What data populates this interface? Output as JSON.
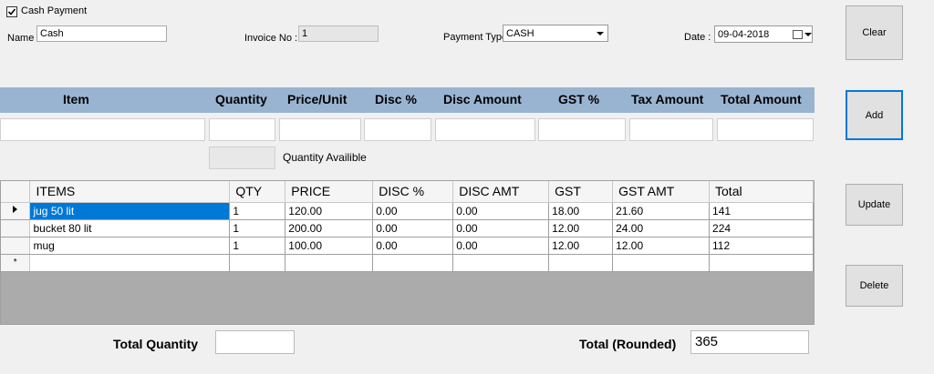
{
  "top": {
    "cash_payment_label": "Cash Payment",
    "cash_payment_checked": true,
    "name_label": "Name",
    "name_value": "Cash",
    "invoice_label": "Invoice No :",
    "invoice_value": "1",
    "payment_type_label": "Payment Type :",
    "payment_type_value": "CASH",
    "date_label": "Date :",
    "date_value": "09-04-2018"
  },
  "entry_header": {
    "item": "Item",
    "quantity": "Quantity",
    "price_unit": "Price/Unit",
    "disc_pct": "Disc %",
    "disc_amount": "Disc Amount",
    "gst_pct": "GST %",
    "tax_amount": "Tax Amount",
    "total_amount": "Total Amount"
  },
  "quantity_available_label": "Quantity Availible",
  "grid": {
    "columns": [
      "ITEMS",
      "QTY",
      "PRICE",
      "DISC %",
      "DISC AMT",
      "GST",
      "GST AMT",
      "Total"
    ],
    "rows": [
      [
        "jug 50 lit",
        "1",
        "120.00",
        "0.00",
        "0.00",
        "18.00",
        "21.60",
        "141"
      ],
      [
        "bucket 80 lit",
        "1",
        "200.00",
        "0.00",
        "0.00",
        "12.00",
        "24.00",
        "224"
      ],
      [
        "mug",
        "1",
        "100.00",
        "0.00",
        "0.00",
        "12.00",
        "12.00",
        "112"
      ]
    ],
    "new_row_marker": "*"
  },
  "buttons": {
    "clear": "Clear",
    "add": "Add",
    "update": "Update",
    "delete": "Delete"
  },
  "totals": {
    "quantity_label": "Total Quantity",
    "quantity_value": "",
    "rounded_label": "Total (Rounded)",
    "rounded_value": "365"
  },
  "colors": {
    "header_strip": "#99b4d1",
    "selection": "#0078d7"
  }
}
